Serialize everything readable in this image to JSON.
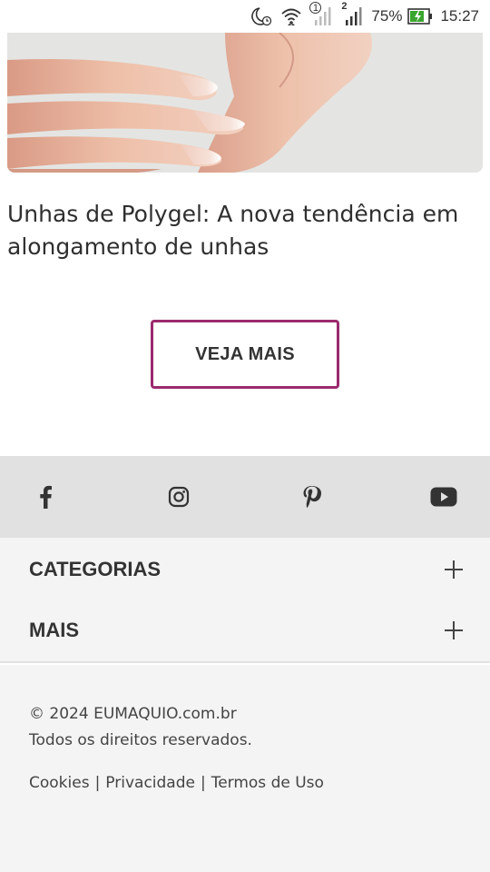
{
  "status_bar": {
    "battery_percent": "75%",
    "time": "15:27",
    "sim1_label": "1",
    "sim2_label": "2",
    "icons": [
      "do-not-disturb-icon",
      "wifi-icon",
      "signal-icon",
      "battery-icon"
    ]
  },
  "article": {
    "title": "Unhas de Polygel: A nova tendência em alongamento de unhas"
  },
  "main": {
    "more_button": "VEJA MAIS",
    "accent_color": "#9b2a6e"
  },
  "social": {
    "icons": [
      "facebook-icon",
      "instagram-icon",
      "pinterest-icon",
      "youtube-icon"
    ]
  },
  "footer": {
    "sections": [
      {
        "label": "CATEGORIAS"
      },
      {
        "label": "MAIS"
      }
    ],
    "copyright": "© 2024 EUMAQUIO.com.br",
    "rights": "Todos os direitos reservados.",
    "links": {
      "cookies": "Cookies",
      "privacy": "Privacidade",
      "terms": "Termos de Uso",
      "separator": "|"
    }
  }
}
